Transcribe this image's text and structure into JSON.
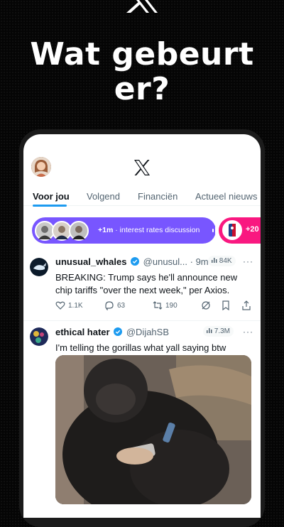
{
  "headline": "Wat gebeurt er?",
  "tabs": [
    "Voor jou",
    "Volgend",
    "Financiën",
    "Actueel nieuws"
  ],
  "spaces": [
    {
      "count": "+1m",
      "title": "interest rates discussion"
    },
    {
      "count": "+20"
    }
  ],
  "tweets": [
    {
      "name": "unusual_whales",
      "handle": "@unusul...",
      "time": "· 9m",
      "views": "84K",
      "text": "BREAKING: Trump says he'll announce new chip tariffs \"over the next week,\" per Axios.",
      "replies": "1.1K",
      "comments": "63",
      "reposts": "190"
    },
    {
      "name": "ethical hater",
      "handle": "@DijahSB",
      "views": "7.3M",
      "text": "I'm telling the gorillas what yall saying btw"
    }
  ],
  "colors": {
    "accent": "#1d9bf0",
    "space_purple": "#7856ff",
    "space_pink": "#f91880",
    "background": "#050505"
  }
}
